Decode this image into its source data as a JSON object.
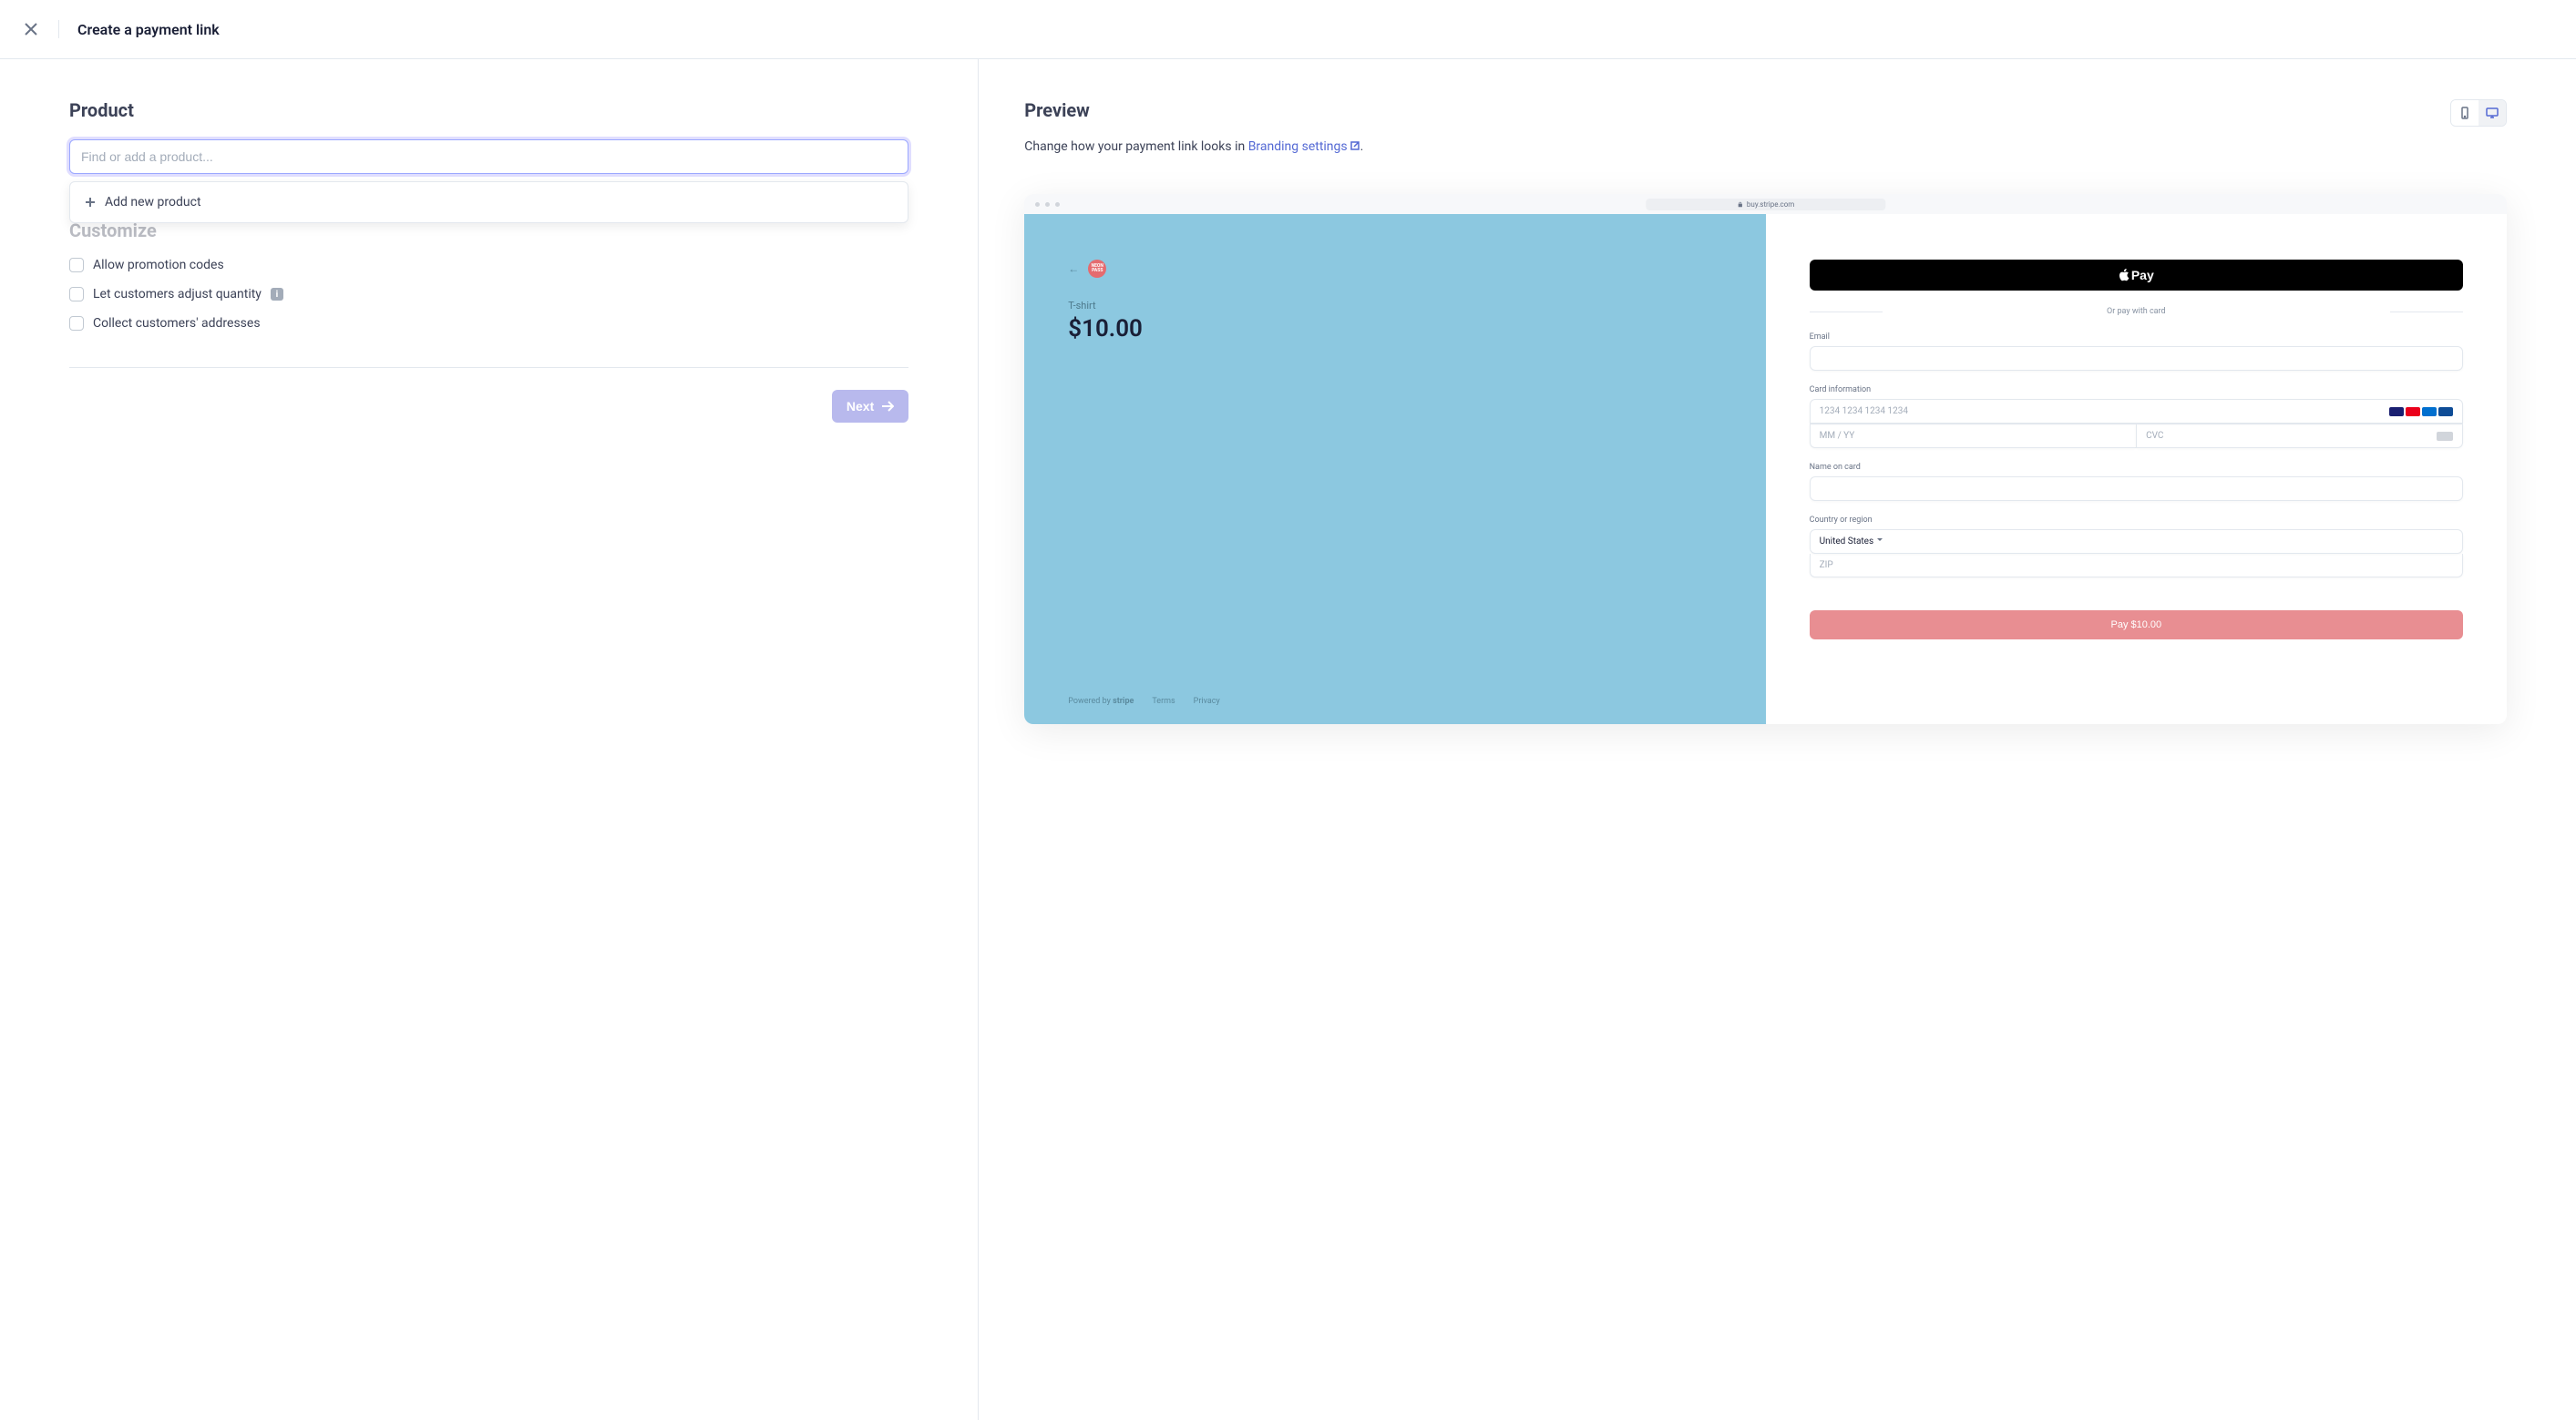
{
  "header": {
    "title": "Create a payment link"
  },
  "left": {
    "product_heading": "Product",
    "product_placeholder": "Find or add a product...",
    "dropdown": {
      "add_new": "Add new product"
    },
    "customize_heading": "Customize",
    "options": {
      "promo": "Allow promotion codes",
      "quantity": "Let customers adjust quantity",
      "addresses": "Collect customers' addresses"
    },
    "next_label": "Next"
  },
  "right": {
    "preview_heading": "Preview",
    "desc_prefix": "Change how your payment link looks in ",
    "branding_link": "Branding settings",
    "url": "buy.stripe.com",
    "checkout": {
      "product_name": "T-shirt",
      "price": "$10.00",
      "powered_by": "Powered by",
      "stripe": "stripe",
      "terms": "Terms",
      "privacy": "Privacy",
      "apple_pay": "Pay",
      "or_text": "Or pay with card",
      "email_label": "Email",
      "card_label": "Card information",
      "card_placeholder": "1234 1234 1234 1234",
      "expiry_placeholder": "MM / YY",
      "cvc_placeholder": "CVC",
      "name_label": "Name on card",
      "country_label": "Country or region",
      "country_value": "United States",
      "zip_placeholder": "ZIP",
      "pay_button": "Pay $10.00"
    }
  }
}
